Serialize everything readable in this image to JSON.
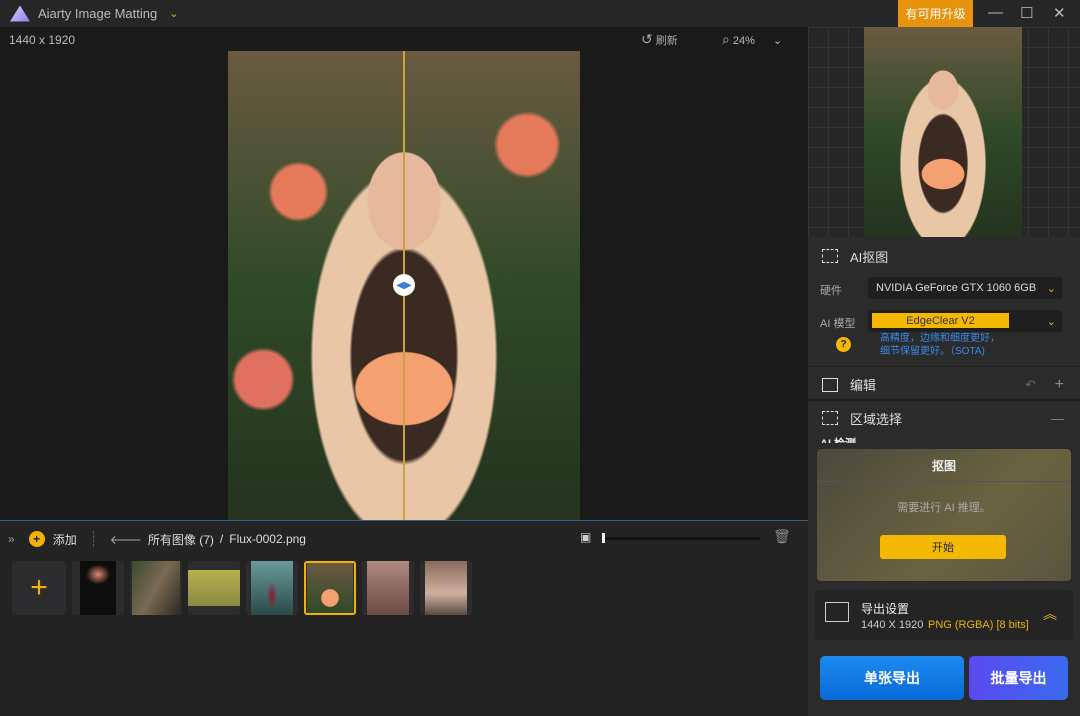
{
  "app": {
    "title": "Aiarty Image Matting",
    "upgrade": "有可用升级"
  },
  "canvas": {
    "dimensions": "1440 x 1920",
    "refresh": "刷新",
    "zoom": "24%"
  },
  "bottom": {
    "add": "添加",
    "breadcrumb_all": "所有图像 (7)",
    "separator": "/",
    "file": "Flux-0002.png",
    "thumb_count": 7,
    "selected_index": 4,
    "slider_percent": 0
  },
  "right": {
    "ai_matting": {
      "title": "AI抠图",
      "hardware_label": "硬件",
      "hardware": "NVIDIA GeForce GTX 1060 6GB",
      "model_label": "AI 模型",
      "model": "EdgeClear  V2",
      "desc1": "高精度，边缘和细度更好，",
      "desc2": "细节保留更好。（SOTA)",
      "help": "?"
    },
    "edit": {
      "title": "编辑"
    },
    "region": {
      "title": "区域选择",
      "sub": "AI 检测"
    },
    "card": {
      "title": "抠图",
      "message": "需要进行 AI 推理。",
      "start": "开始"
    },
    "export": {
      "title": "导出设置",
      "size": "1440 X 1920",
      "format": "PNG (RGBA) [8 bits]"
    },
    "single_export": "单张导出",
    "batch_export": "批量导出"
  }
}
